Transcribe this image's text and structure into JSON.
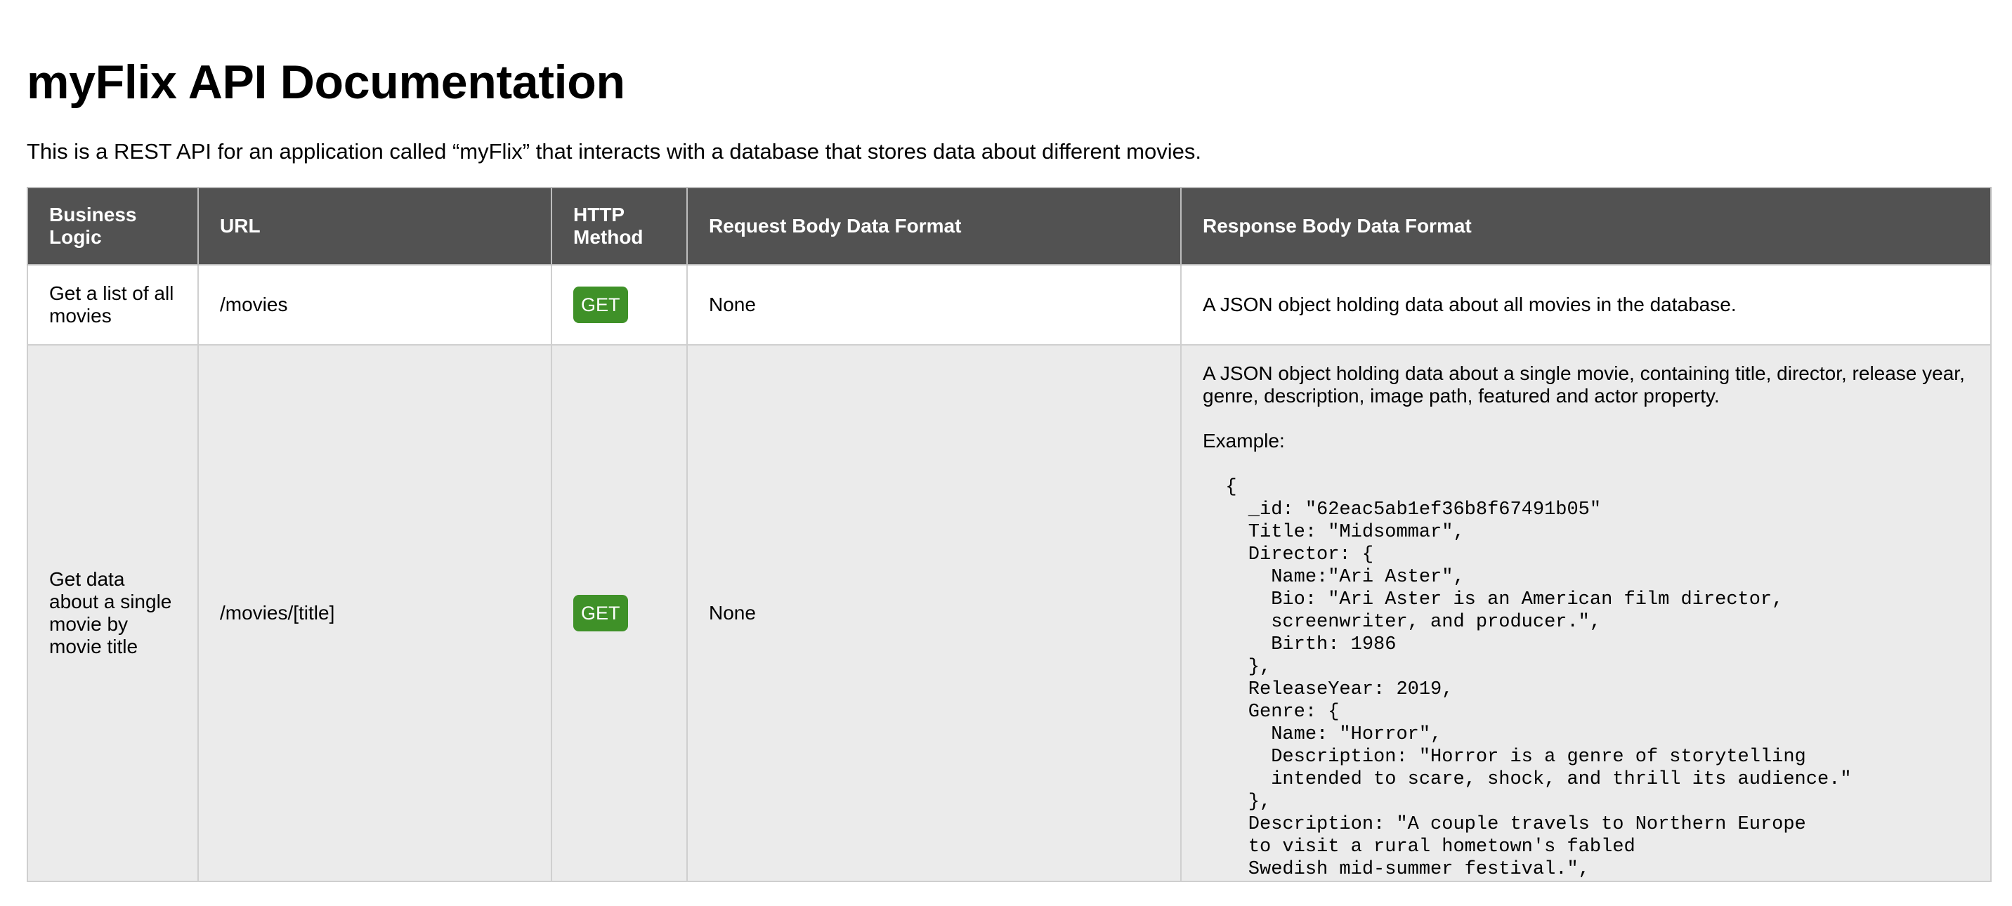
{
  "page": {
    "title": "myFlix API Documentation",
    "intro": "This is a REST API for an application called “myFlix” that interacts with a database that stores data about different movies."
  },
  "table": {
    "headers": {
      "business_logic": "Business Logic",
      "url": "URL",
      "http_method": "HTTP Method",
      "request_body": "Request Body Data Format",
      "response_body": "Response Body Data Format"
    },
    "rows": [
      {
        "business_logic": "Get a list of all movies",
        "url": "/movies",
        "method": "GET",
        "request_body": "None",
        "response_body": "A JSON object holding data about all movies in the database."
      },
      {
        "business_logic": "Get data about a single movie by movie title",
        "url": "/movies/[title]",
        "method": "GET",
        "request_body": "None",
        "response_body": "A JSON object holding data about a single movie, containing title, director, release year, genre, description, image path, featured and actor property.",
        "example_label": "Example:",
        "example_code": "  {\n    _id: \"62eac5ab1ef36b8f67491b05\"\n    Title: \"Midsommar\",\n    Director: {\n      Name:\"Ari Aster\",\n      Bio: \"Ari Aster is an American film director,\n      screenwriter, and producer.\",\n      Birth: 1986\n    },\n    ReleaseYear: 2019,\n    Genre: {\n      Name: \"Horror\",\n      Description: \"Horror is a genre of storytelling\n      intended to scare, shock, and thrill its audience.\"\n    },\n    Description: \"A couple travels to Northern Europe\n    to visit a rural hometown's fabled\n    Swedish mid-summer festival.\","
      }
    ]
  },
  "colors": {
    "header_bg": "#525252",
    "get_badge": "#3f9128",
    "alt_row_bg": "#ebebeb"
  }
}
